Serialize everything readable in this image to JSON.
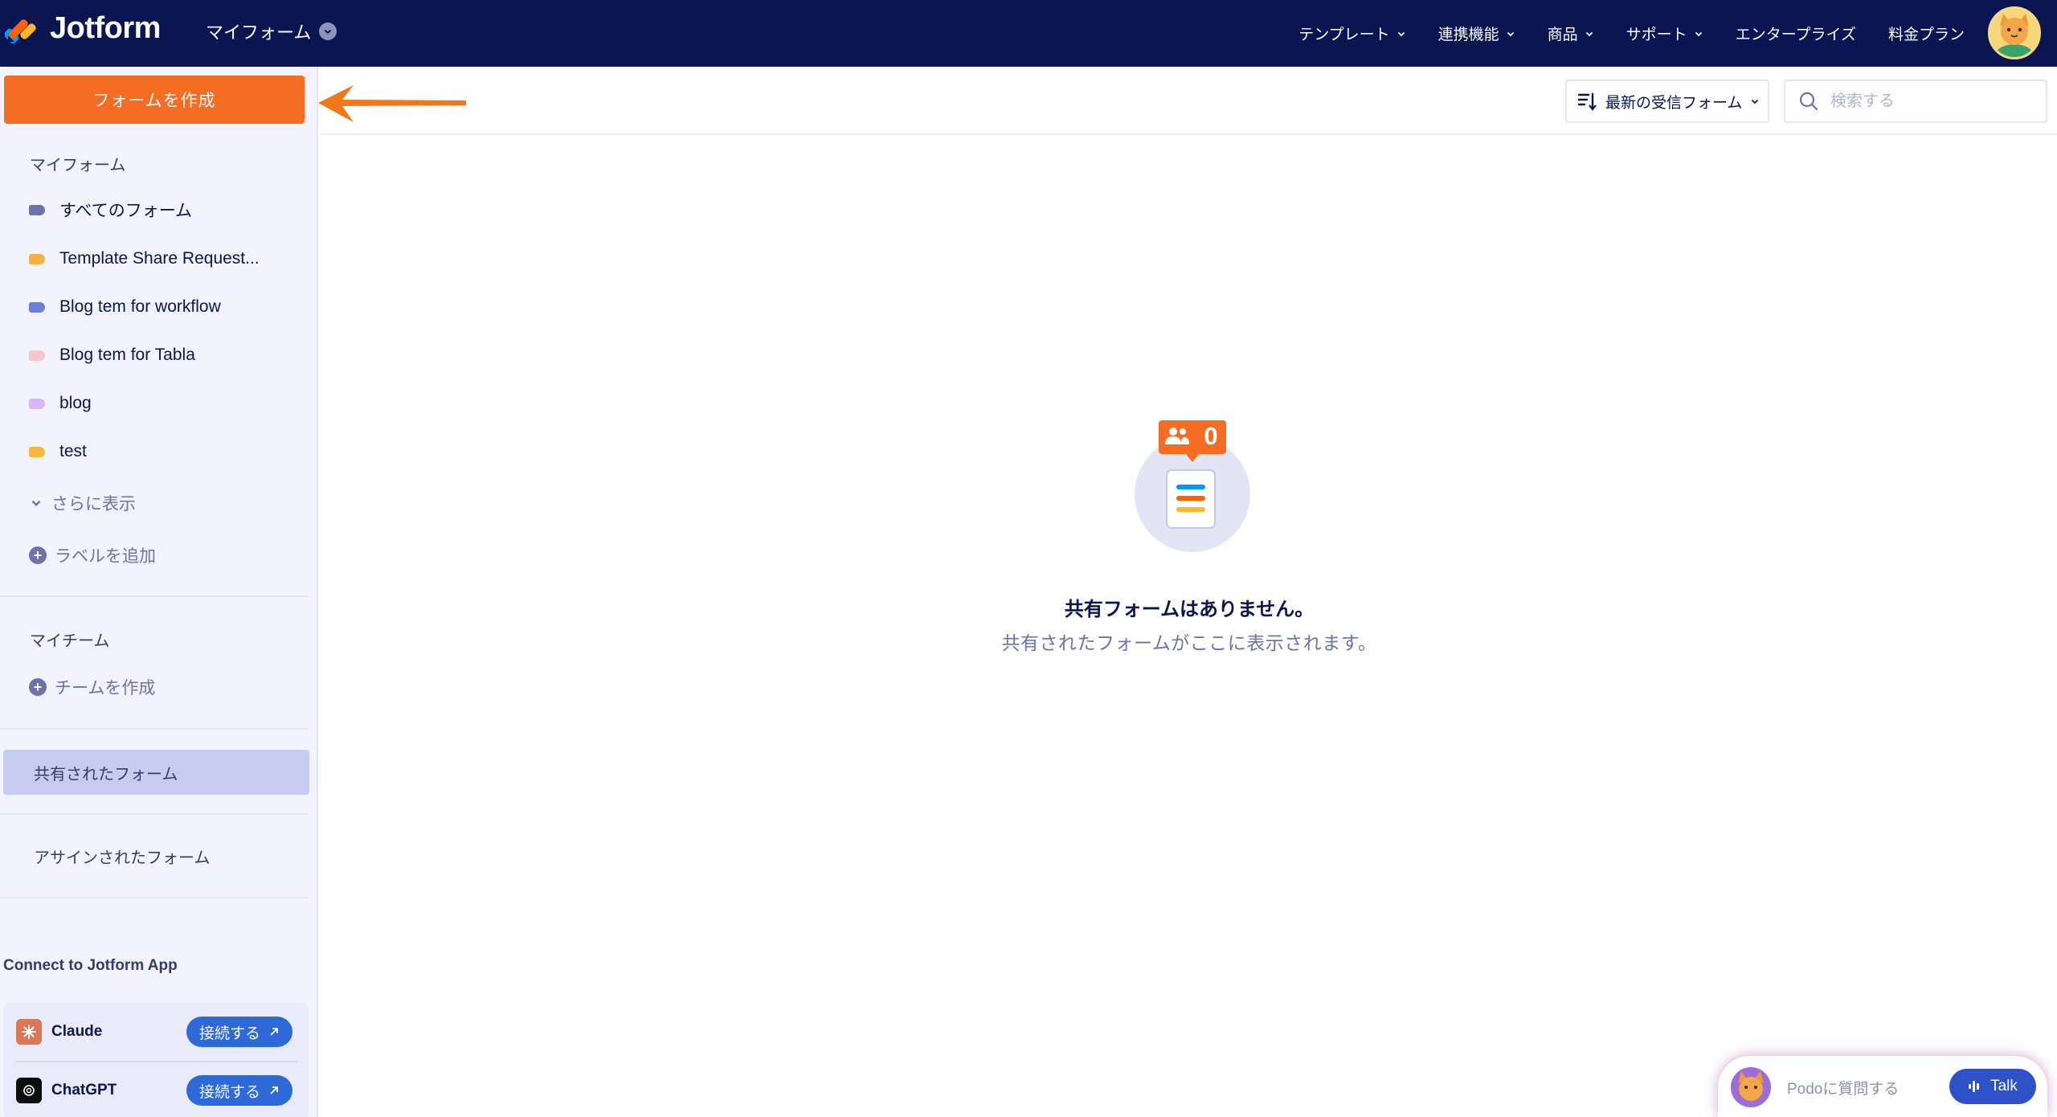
{
  "topbar": {
    "brand": "Jotform",
    "my_forms": "マイフォーム",
    "nav": [
      {
        "label": "テンプレート",
        "has_dropdown": true
      },
      {
        "label": "連携機能",
        "has_dropdown": true
      },
      {
        "label": "商品",
        "has_dropdown": true
      },
      {
        "label": "サポート",
        "has_dropdown": true
      },
      {
        "label": "エンタープライズ",
        "has_dropdown": false
      },
      {
        "label": "料金プラン",
        "has_dropdown": false
      }
    ]
  },
  "sidebar": {
    "create_button": "フォームを作成",
    "my_forms_heading": "マイフォーム",
    "labels": [
      {
        "label": "すべてのフォーム",
        "color": "#6c73a8"
      },
      {
        "label": "Template Share Request...",
        "color": "#f6b046"
      },
      {
        "label": "Blog tem for workflow",
        "color": "#6e7fd6"
      },
      {
        "label": "Blog tem for Tabla",
        "color": "#f6c6cf"
      },
      {
        "label": "blog",
        "color": "#d9b6f5"
      },
      {
        "label": "test",
        "color": "#f6b83a"
      }
    ],
    "show_more": "さらに表示",
    "add_label": "ラベルを追加",
    "my_team_heading": "マイチーム",
    "create_team": "チームを作成",
    "shared_forms": "共有されたフォーム",
    "assigned_forms": "アサインされたフォーム",
    "connect_title": "Connect to Jotform App",
    "connections": [
      {
        "name": "Claude",
        "button": "接続する"
      },
      {
        "name": "ChatGPT",
        "button": "接続する"
      }
    ]
  },
  "toolbar": {
    "sort_label": "最新の受信フォーム",
    "search_placeholder": "検索する"
  },
  "empty_state": {
    "badge_count": "0",
    "title": "共有フォームはありません。",
    "subtitle": "共有されたフォームがここに表示されます。"
  },
  "podo": {
    "prompt": "Podoに質問する",
    "talk_button": "Talk"
  },
  "colors": {
    "navbar": "#0a1551",
    "accent_orange": "#f56d23",
    "connect_blue": "#2e69d8"
  }
}
